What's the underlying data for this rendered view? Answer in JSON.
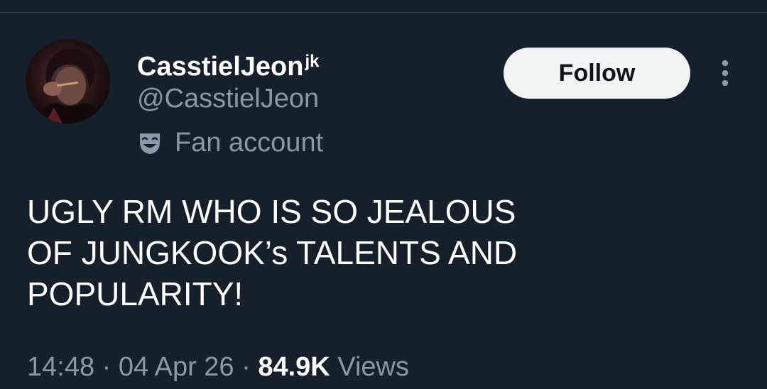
{
  "tweet": {
    "display_name": "CasstielJeon",
    "display_name_suffix": "jk",
    "handle": "@CasstielJeon",
    "account_label": "Fan account",
    "account_label_icon": "theater-mask-icon",
    "follow_label": "Follow",
    "more_icon": "more-vertical-icon",
    "text": "UGLY RM WHO IS SO JEALOUS\nOF JUNGKOOK’s TALENTS AND\nPOPULARITY!",
    "time": "14:48",
    "separator1": " · ",
    "date": "04 Apr 26",
    "separator2": " · ",
    "views_count": "84.9K",
    "views_label": " Views"
  },
  "colors": {
    "background": "#15202b",
    "primary_text": "#ffffff",
    "secondary_text": "#8b98a5",
    "follow_bg": "#eff3f4",
    "follow_text": "#0f1419",
    "divider": "#38444d"
  }
}
